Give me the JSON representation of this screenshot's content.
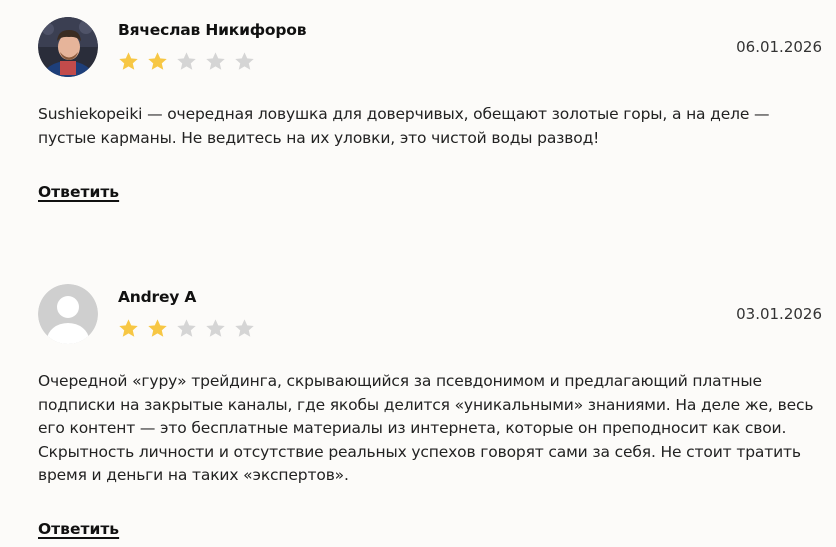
{
  "reviews": [
    {
      "author": "Вячеслав Никифоров",
      "date": "06.01.2026",
      "rating": 2,
      "max_rating": 5,
      "text": "Sushiekopeiki — очередная ловушка для доверчивых, обещают золотые горы, а на деле — пустые карманы. Не ведитесь на их уловки, это чистой воды развод!",
      "reply_label": "Ответить",
      "avatar": "user-photo"
    },
    {
      "author": "Andrey A",
      "date": "03.01.2026",
      "rating": 2,
      "max_rating": 5,
      "text": "Очередной «гуру» трейдинга, скрывающийся за псевдонимом и предлагающий платные подписки на закрытые каналы, где якобы делится «уникальными» знаниями. На деле же, весь его контент — это бесплатные материалы из интернета, которые он преподносит как свои. Скрытность личности и отсутствие реальных успехов говорят сами за себя. Не стоит тратить время и деньги на таких «экспертов».",
      "reply_label": "Ответить",
      "avatar": "default-avatar"
    }
  ],
  "colors": {
    "star_filled": "#f7c744",
    "star_empty": "#d5d5d5",
    "background": "#fcfbf9",
    "placeholder_avatar": "#cfcfcf"
  }
}
